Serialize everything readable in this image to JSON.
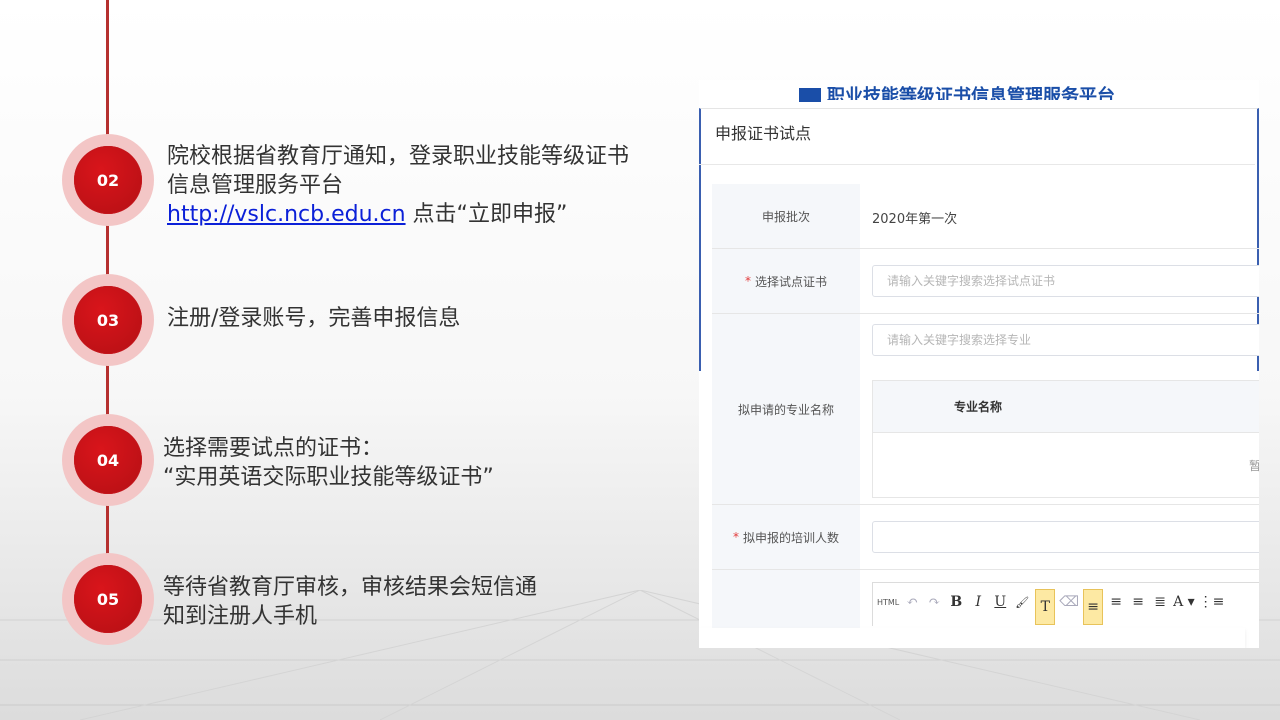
{
  "steps": [
    {
      "num": "02",
      "line1": "院校根据省教育厅通知，登录职业技能等级证书",
      "line2": "信息管理服务平台",
      "link": "http://vslc.ncb.edu.cn",
      "line3_rest": " 点击“立即申报”"
    },
    {
      "num": "03",
      "line1": "注册/登录账号，完善申报信息"
    },
    {
      "num": "04",
      "line1": "选择需要试点的证书：",
      "line2": "“实用英语交际职业技能等级证书”"
    },
    {
      "num": "05",
      "line1": "等待省教育厅审核，审核结果会短信通",
      "line2": "知到注册人手机"
    }
  ],
  "screenshot": {
    "site_title": "职业技能等级证书信息管理服务平台",
    "header": "申报证书试点",
    "rows": [
      {
        "label": "申报批次",
        "value": "2020年第一次"
      },
      {
        "label": "选择试点证书",
        "required": "*",
        "placeholder": "请输入关键字搜索选择试点证书"
      },
      {
        "label": "拟申请的专业名称",
        "placeholder": "请输入关键字搜索选择专业",
        "table_header": "专业名称",
        "empty_text": "暂无"
      },
      {
        "label": "拟申报的培训人数",
        "required": "*"
      }
    ],
    "toolbar": [
      {
        "name": "html",
        "label": "HTML"
      },
      {
        "name": "undo",
        "label": "↶"
      },
      {
        "name": "redo",
        "label": "↷"
      },
      {
        "name": "bold",
        "label": "B"
      },
      {
        "name": "italic",
        "label": "I"
      },
      {
        "name": "underline",
        "label": "U"
      },
      {
        "name": "format-brush",
        "label": "🖌"
      },
      {
        "name": "paste-text",
        "label": "T"
      },
      {
        "name": "eraser",
        "label": "⌫"
      },
      {
        "name": "align-left",
        "label": "≡"
      },
      {
        "name": "align-right",
        "label": "≡"
      },
      {
        "name": "align-center",
        "label": "≡"
      },
      {
        "name": "justify",
        "label": "≣"
      },
      {
        "name": "font-color",
        "label": "A ▾"
      },
      {
        "name": "list",
        "label": "⋮≡"
      }
    ]
  },
  "colors": {
    "accent": "#c4161c",
    "timeline": "#b5302f",
    "link": "#0b20d8"
  }
}
